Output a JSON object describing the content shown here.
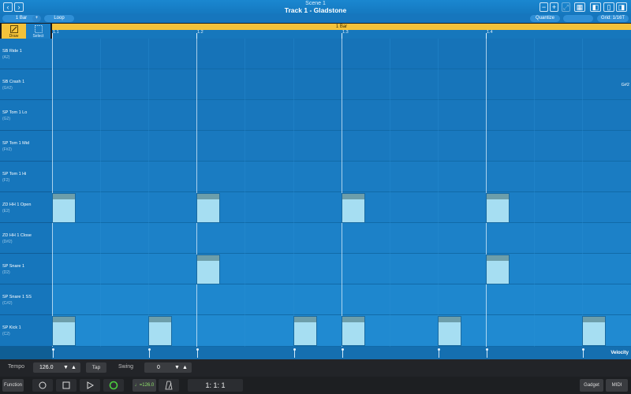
{
  "titlebar": {
    "scene": "Scene 1",
    "track": "Track 1 - Gladstone",
    "back_icon": "chevron-left-icon",
    "forward_icon": "chevron-right-icon",
    "minus_label": "−",
    "plus_label": "+"
  },
  "toolbar": {
    "length_label": "1 Bar",
    "add_label": "+",
    "loop_label": "Loop",
    "quantize_label": "Quantize",
    "grid_label": "Grid: 1/16T"
  },
  "tools": {
    "draw_label": "Draw",
    "select_label": "Select"
  },
  "loop_region": {
    "label": "1 Bar"
  },
  "ruler": {
    "marks": [
      "1.1",
      "1.2",
      "1.3",
      "1.4"
    ]
  },
  "lanes": [
    {
      "name": "SB Ride 1",
      "note": "(A2)"
    },
    {
      "name": "SB Crash 1",
      "note": "(G#2)"
    },
    {
      "name": "SP Tom 1 Lo",
      "note": "(G2)"
    },
    {
      "name": "SP Tom 1 Mid",
      "note": "(F#2)"
    },
    {
      "name": "SP Tom 1 Hi",
      "note": "(F2)"
    },
    {
      "name": "ZD HH 1 Open",
      "note": "(E2)"
    },
    {
      "name": "ZD HH 1 Close",
      "note": "(D#2)"
    },
    {
      "name": "SP Snare 1",
      "note": "(D2)"
    },
    {
      "name": "SP Snare 1 SS",
      "note": "(C#2)"
    },
    {
      "name": "SP Kick 1",
      "note": "(C2)"
    }
  ],
  "pitch_hint": "G#2",
  "velocity": {
    "label": "Velocity"
  },
  "tempo_row": {
    "tempo_label": "Tempo",
    "tempo_value": "126.0",
    "tap_label": "Tap",
    "swing_label": "Swing",
    "swing_value": "0"
  },
  "transport": {
    "function_label": "Function",
    "tempo_display": "♩=126.0",
    "position": "1:    1:    1",
    "gadget_label": "Gadget",
    "midi_label": "MIDI"
  }
}
